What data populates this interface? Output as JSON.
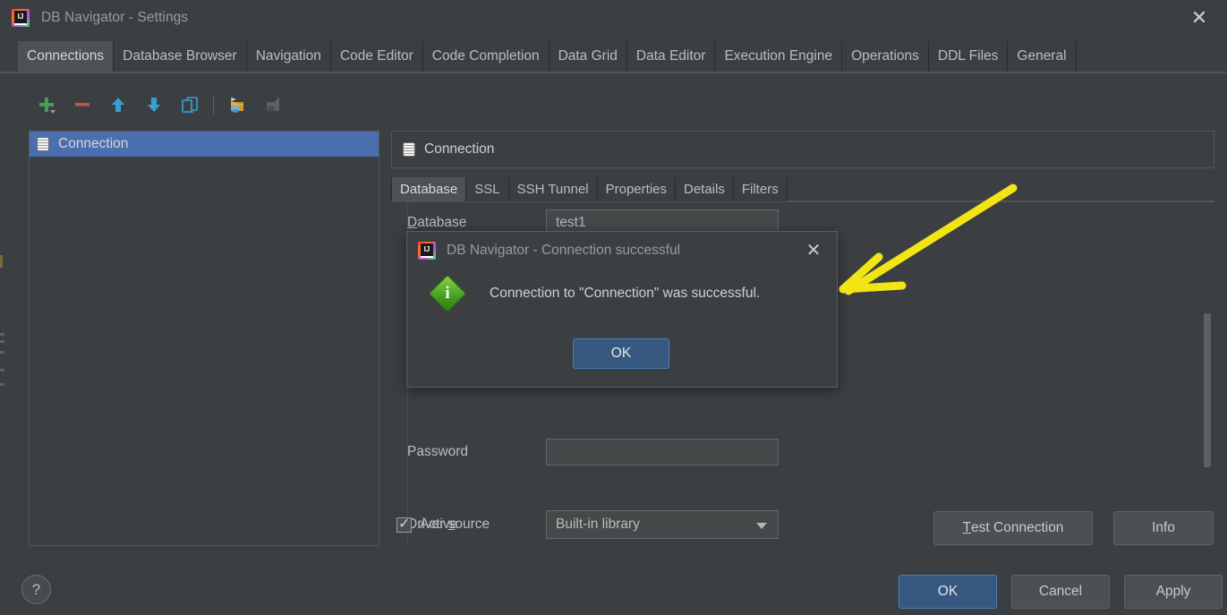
{
  "window": {
    "title": "DB Navigator - Settings",
    "logo_icon": "intellij-idea-icon",
    "close_icon": "close-icon"
  },
  "tabs": [
    {
      "label": "Connections",
      "active": true
    },
    {
      "label": "Database Browser",
      "active": false
    },
    {
      "label": "Navigation",
      "active": false
    },
    {
      "label": "Code Editor",
      "active": false
    },
    {
      "label": "Code Completion",
      "active": false
    },
    {
      "label": "Data Grid",
      "active": false
    },
    {
      "label": "Data Editor",
      "active": false
    },
    {
      "label": "Execution Engine",
      "active": false
    },
    {
      "label": "Operations",
      "active": false
    },
    {
      "label": "DDL Files",
      "active": false
    },
    {
      "label": "General",
      "active": false
    }
  ],
  "toolbar": {
    "buttons": [
      {
        "name": "add-connection-button",
        "icon": "plus-icon",
        "enabled": true
      },
      {
        "name": "remove-connection-button",
        "icon": "minus-icon",
        "enabled": true
      },
      {
        "name": "move-up-button",
        "icon": "arrow-up-icon",
        "enabled": true
      },
      {
        "name": "move-down-button",
        "icon": "arrow-down-icon",
        "enabled": true
      },
      {
        "name": "duplicate-connection-button",
        "icon": "copy-icon",
        "enabled": true
      },
      {
        "name": "import-connection-button",
        "icon": "import-database-icon",
        "enabled": true
      },
      {
        "name": "export-connection-button",
        "icon": "export-database-icon",
        "enabled": false
      }
    ]
  },
  "connection_list": {
    "items": [
      {
        "label": "Connection",
        "icon": "database-icon",
        "selected": true
      }
    ]
  },
  "panel": {
    "header_title": "Connection",
    "header_icon": "database-icon",
    "sub_tabs": [
      {
        "label": "Database",
        "active": true
      },
      {
        "label": "SSL",
        "active": false
      },
      {
        "label": "SSH Tunnel",
        "active": false
      },
      {
        "label": "Properties",
        "active": false
      },
      {
        "label": "Details",
        "active": false
      },
      {
        "label": "Filters",
        "active": false
      }
    ],
    "fields": {
      "database": {
        "label": "Database",
        "mnemonic": "D",
        "label_rest": "atabase",
        "value": "test1"
      },
      "password": {
        "label": "Password",
        "value": ""
      },
      "driver_source": {
        "label_pre": "Driver ",
        "mnemonic": "s",
        "label_rest": "ource",
        "value": "Built-in library",
        "dropdown_icon": "chevron-down-icon"
      }
    },
    "active_checkbox": {
      "label": "Active",
      "checked": true
    },
    "test_connection_button": {
      "mnemonic": "T",
      "label_rest": "est Connection"
    },
    "info_button": {
      "label": "Info"
    }
  },
  "dialog": {
    "logo_icon": "intellij-idea-icon",
    "title": "DB Navigator - Connection successful",
    "close_icon": "close-icon",
    "status_icon": "info-diamond-icon",
    "status_glyph": "i",
    "message": "Connection to \"Connection\" was successful.",
    "ok_label": "OK"
  },
  "footer": {
    "help_label": "?",
    "ok_label": "OK",
    "cancel_label": "Cancel",
    "apply_label": "Apply"
  },
  "annotation": {
    "type": "arrow",
    "color": "#f2e516",
    "points_to": "dialog-right-side"
  },
  "colors": {
    "window_bg": "#3c3f41",
    "tab_active_bg": "#4e5254",
    "selection_blue": "#4b6eaf",
    "primary_button": "#365880",
    "input_bg": "#45494a",
    "text": "#bbbbbb",
    "value_text": "#a9b7c6",
    "annotation_yellow": "#f2e516",
    "success_green": "#49a023"
  }
}
